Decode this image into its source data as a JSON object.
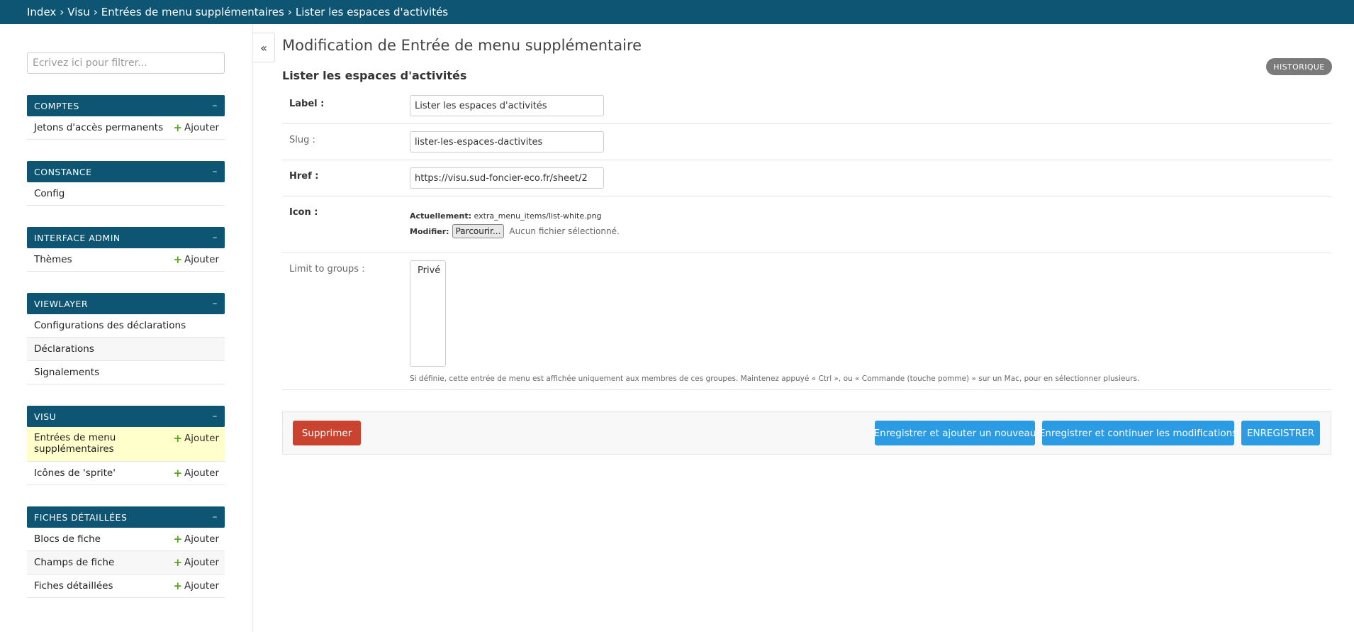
{
  "breadcrumb": {
    "items": [
      "Index",
      "Visu",
      "Entrées de menu supplémentaires",
      "Lister les espaces d'activités"
    ],
    "separator": "›"
  },
  "sidebar": {
    "filter_placeholder": "Écrivez ici pour filtrer...",
    "collapse_symbol": "–",
    "add_label": "Ajouter",
    "modules": [
      {
        "title": "COMPTES",
        "items": [
          {
            "label": "Jetons d'accès permanents",
            "add": true
          }
        ]
      },
      {
        "title": "CONSTANCE",
        "items": [
          {
            "label": "Config",
            "add": false
          }
        ]
      },
      {
        "title": "INTERFACE ADMIN",
        "items": [
          {
            "label": "Thèmes",
            "add": true
          }
        ]
      },
      {
        "title": "VIEWLAYER",
        "items": [
          {
            "label": "Configurations des déclarations",
            "add": false
          },
          {
            "label": "Déclarations",
            "add": false
          },
          {
            "label": "Signalements",
            "add": false
          }
        ]
      },
      {
        "title": "VISU",
        "items": [
          {
            "label": "Entrées de menu supplémentaires",
            "add": true,
            "active": true
          },
          {
            "label": "Icônes de 'sprite'",
            "add": true
          }
        ]
      },
      {
        "title": "FICHES DÉTAILLÉES",
        "items": [
          {
            "label": "Blocs de fiche",
            "add": true
          },
          {
            "label": "Champs de fiche",
            "add": true
          },
          {
            "label": "Fiches détaillées",
            "add": true
          }
        ]
      }
    ]
  },
  "toggle_symbol": "«",
  "main": {
    "title": "Modification de Entrée de menu supplémentaire",
    "history_label": "HISTORIQUE",
    "fieldset_title": "Lister les espaces d'activités",
    "fields": {
      "label": {
        "label": "Label :",
        "value": "Lister les espaces d'activités"
      },
      "slug": {
        "label": "Slug :",
        "value": "lister-les-espaces-dactivites"
      },
      "href": {
        "label": "Href :",
        "value": "https://visu.sud-foncier-eco.fr/sheet/2"
      },
      "icon": {
        "label": "Icon :",
        "current_label": "Actuellement:",
        "current_value": "extra_menu_items/list-white.png",
        "change_label": "Modifier:",
        "browse_label": "Parcourir...",
        "no_file": "Aucun fichier sélectionné."
      },
      "groups": {
        "label": "Limit to groups :",
        "options": [
          "Privé"
        ],
        "help": "Si définie, cette entrée de menu est affichée uniquement aux membres de ces groupes. Maintenez appuyé « Ctrl », ou « Commande (touche pomme) » sur un Mac, pour en sélectionner plusieurs."
      }
    },
    "buttons": {
      "delete": "Supprimer",
      "save_add": "Enregistrer et ajouter un nouveau",
      "save_continue": "Enregistrer et continuer les modifications",
      "save": "ENREGISTRER"
    }
  },
  "colors": {
    "header": "#0e5573",
    "active_row": "#ffffcc",
    "delete": "#c9432e",
    "primary": "#2b9be3",
    "add_plus": "#5aa321"
  }
}
